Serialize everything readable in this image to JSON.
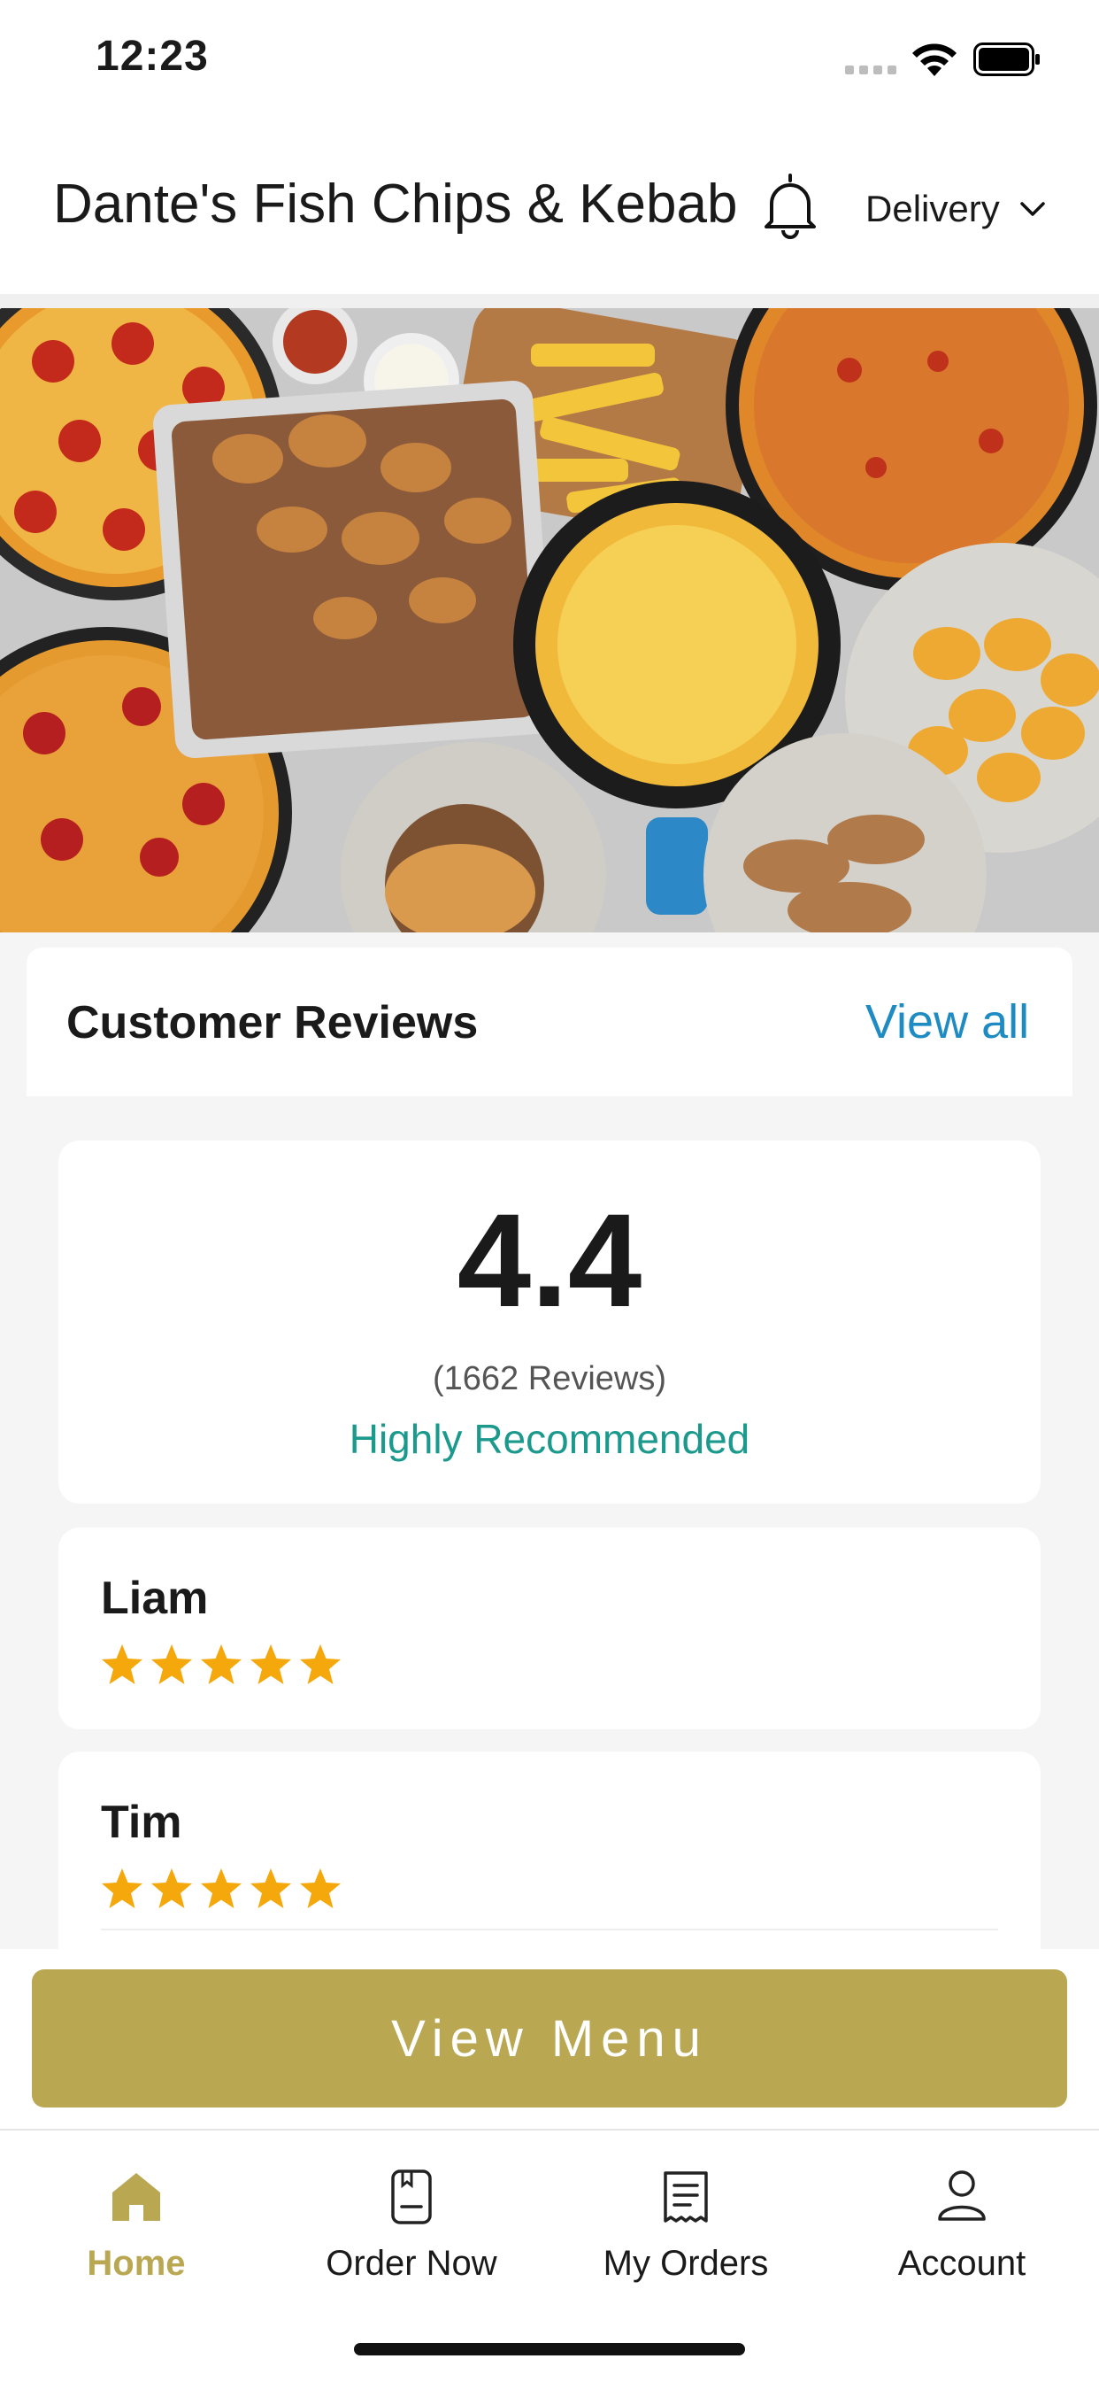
{
  "status_bar": {
    "time": "12:23"
  },
  "header": {
    "title": "Dante's Fish Chips & Kebab",
    "order_mode": "Delivery",
    "icons": [
      "bell-icon",
      "chevron-down-icon"
    ]
  },
  "reviews": {
    "section_title": "Customer Reviews",
    "view_all_label": "View all",
    "summary": {
      "rating": "4.4",
      "count_text": "(1662 Reviews)",
      "recommendation": "Highly Recommended"
    },
    "items": [
      {
        "name": "Liam",
        "stars": 5
      },
      {
        "name": "Tim",
        "stars": 5
      }
    ]
  },
  "cta": {
    "view_menu_label": "View Menu"
  },
  "tab_bar": {
    "tabs": [
      {
        "label": "Home",
        "icon": "home-icon",
        "active": true
      },
      {
        "label": "Order Now",
        "icon": "order-icon",
        "active": false
      },
      {
        "label": "My Orders",
        "icon": "receipt-icon",
        "active": false
      },
      {
        "label": "Account",
        "icon": "user-icon",
        "active": false
      }
    ]
  },
  "colors": {
    "accent": "#b9a752",
    "link": "#1e8bc3",
    "recommend": "#1a998c",
    "star": "#f5a80c"
  }
}
